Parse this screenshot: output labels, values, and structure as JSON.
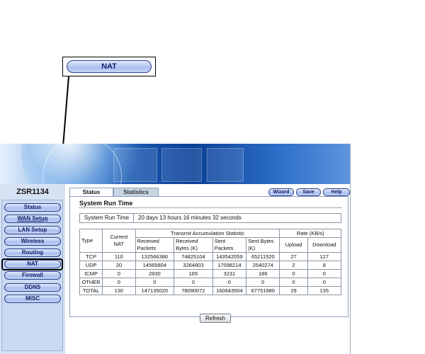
{
  "callout": {
    "label": "NAT"
  },
  "model": "ZSR1134",
  "nav": {
    "items": [
      {
        "label": "Status"
      },
      {
        "label": "WAN Setup"
      },
      {
        "label": "LAN Setup"
      },
      {
        "label": "Wireless"
      },
      {
        "label": "Routing"
      },
      {
        "label": "NAT"
      },
      {
        "label": "Firewall"
      },
      {
        "label": "DDNS"
      },
      {
        "label": "MISC"
      }
    ]
  },
  "tabs": {
    "status": "Status",
    "statistics": "Statistics"
  },
  "actions": {
    "wizard": "Wizard",
    "save": "Save",
    "help": "Help"
  },
  "section": {
    "title": "System Run Time"
  },
  "runtime": {
    "label": "System Run Time",
    "value": "20 days  13 hours  16 minutes  32 seconds"
  },
  "table": {
    "h": {
      "type": "Type",
      "current_nat": "Current NAT",
      "transmit": "Transmit Accumulation Statistic",
      "rate": "Rate (KB/s)",
      "received_packets": "Received Packets",
      "received_bytes": "Received Bytes (K)",
      "sent_packets": "Sent Packets",
      "sent_bytes": "Sent Bytes (K)",
      "upload": "Upload",
      "download": "Download"
    },
    "rows": [
      [
        "TCP",
        "110",
        "132566386",
        "74825104",
        "143542059",
        "65211520",
        "27",
        "127"
      ],
      [
        "UDP",
        "20",
        "14565804",
        "3264803",
        "17098214",
        "2540274",
        "2",
        "8"
      ],
      [
        "ICMP",
        "0",
        "2830",
        "165",
        "3231",
        "186",
        "0",
        "0"
      ],
      [
        "OTHER",
        "0",
        "0",
        "0",
        "0",
        "0",
        "0",
        "0"
      ],
      [
        "TOTAL",
        "130",
        "147135020",
        "78090072",
        "160643504",
        "67751980",
        "29",
        "135"
      ]
    ]
  },
  "refresh_label": "Refresh",
  "colors": {
    "accent": "#2b3f8f",
    "banner": "#0a3f96",
    "sidebar": "#d6e2f3"
  }
}
